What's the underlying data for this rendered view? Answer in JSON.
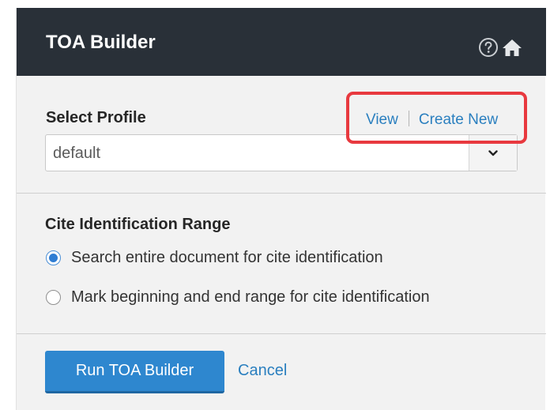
{
  "header": {
    "title": "TOA Builder",
    "help_icon": "help-circle-icon",
    "home_icon": "home-icon"
  },
  "profile": {
    "label": "Select Profile",
    "view_link": "View",
    "create_new_link": "Create New",
    "selected_value": "default",
    "dropdown_icon": "chevron-down-icon"
  },
  "cite_range": {
    "label": "Cite Identification Range",
    "options": [
      {
        "label": "Search entire document for cite identification",
        "checked": true
      },
      {
        "label": "Mark beginning and end range for cite identification",
        "checked": false
      }
    ]
  },
  "actions": {
    "run_label": "Run TOA Builder",
    "cancel_label": "Cancel"
  },
  "colors": {
    "header_bg": "#293038",
    "accent": "#2e87cf",
    "link": "#2a7fbf",
    "highlight": "#e8393f"
  }
}
